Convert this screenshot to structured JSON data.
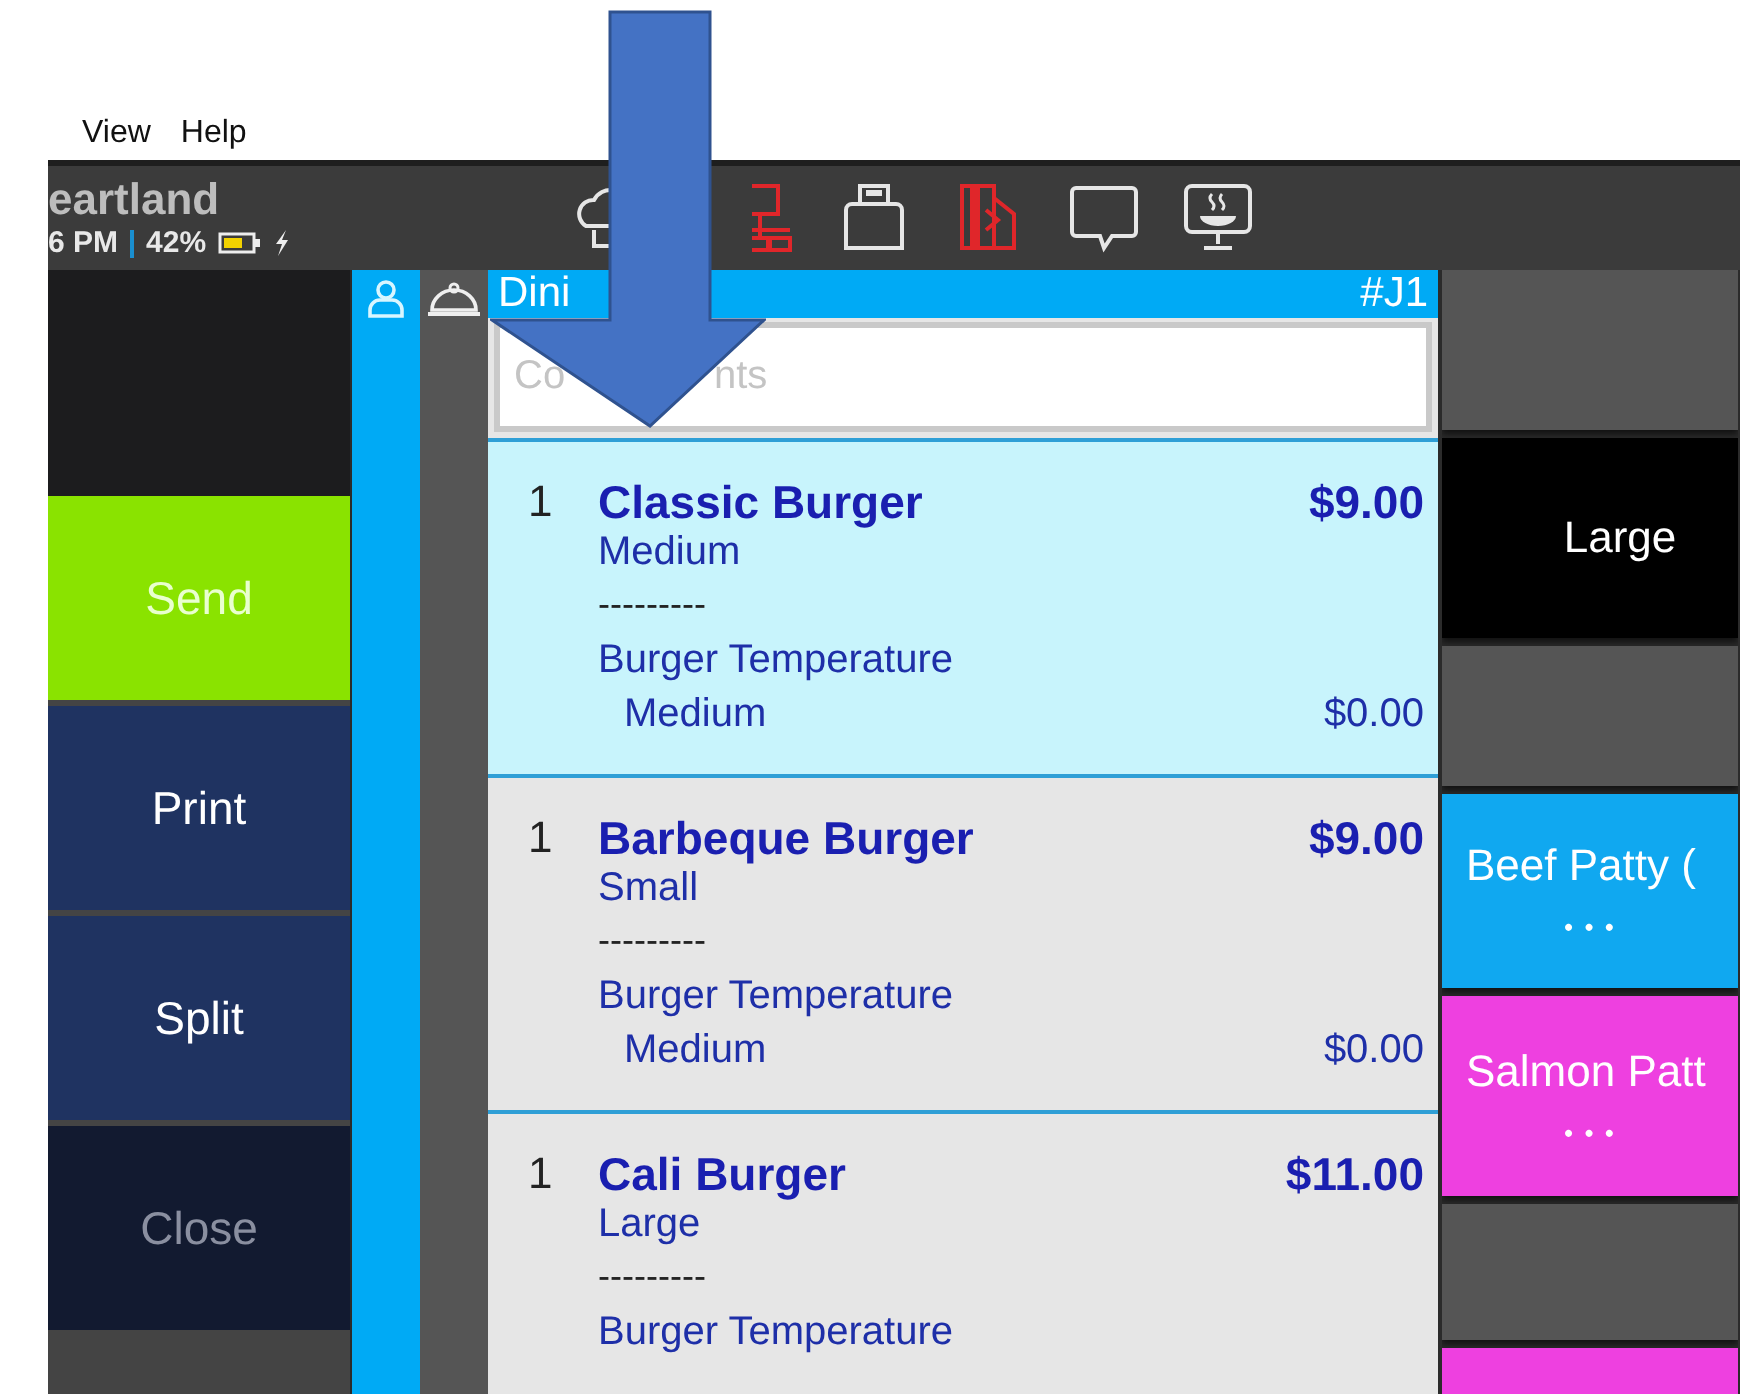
{
  "menu": [
    "View",
    "Help"
  ],
  "header": {
    "brand": "eartland",
    "time": "6 PM",
    "battery": "42%",
    "status_icons": [
      {
        "kind": "cloud",
        "alert": false
      },
      {
        "kind": "network",
        "alert": true
      },
      {
        "kind": "printer",
        "alert": false
      },
      {
        "kind": "card",
        "alert": true
      },
      {
        "kind": "chat",
        "alert": false
      },
      {
        "kind": "kitchen-display",
        "alert": false
      }
    ]
  },
  "actions": [
    {
      "label": "Send",
      "primary": true,
      "disabled": false
    },
    {
      "label": "Print",
      "primary": false,
      "disabled": false
    },
    {
      "label": "Split",
      "primary": false,
      "disabled": false
    },
    {
      "label": "Close",
      "primary": false,
      "disabled": true
    }
  ],
  "order": {
    "title": "Dini",
    "number": "#J1",
    "comments": {
      "placeholder": "Co",
      "placeholder_tail": "nts"
    },
    "items": [
      {
        "qty": "1",
        "name": "Classic Burger",
        "price": "$9.00",
        "size": "Medium",
        "divider": "---------",
        "modifier_group": "Burger Temperature",
        "modifier": "Medium",
        "modifier_price": "$0.00",
        "selected": true
      },
      {
        "qty": "1",
        "name": "Barbeque Burger",
        "price": "$9.00",
        "size": "Small",
        "divider": "---------",
        "modifier_group": "Burger Temperature",
        "modifier": "Medium",
        "modifier_price": "$0.00",
        "selected": false
      },
      {
        "qty": "1",
        "name": "Cali Burger",
        "price": "$11.00",
        "size": "Large",
        "divider": "---------",
        "modifier_group": "Burger Temperature",
        "selected": false
      }
    ]
  },
  "tiles": [
    {
      "kind": "blank"
    },
    {
      "kind": "item",
      "label": "Large",
      "color": "#000000"
    },
    {
      "kind": "blank"
    },
    {
      "kind": "item",
      "label": "Beef Patty (",
      "more": "• • •",
      "color": "#10a8f0"
    },
    {
      "kind": "item",
      "label": "Salmon Patt",
      "more": "• • •",
      "color": "#ee40e0"
    },
    {
      "kind": "blank"
    },
    {
      "kind": "item",
      "color": "#ee40e0"
    }
  ]
}
